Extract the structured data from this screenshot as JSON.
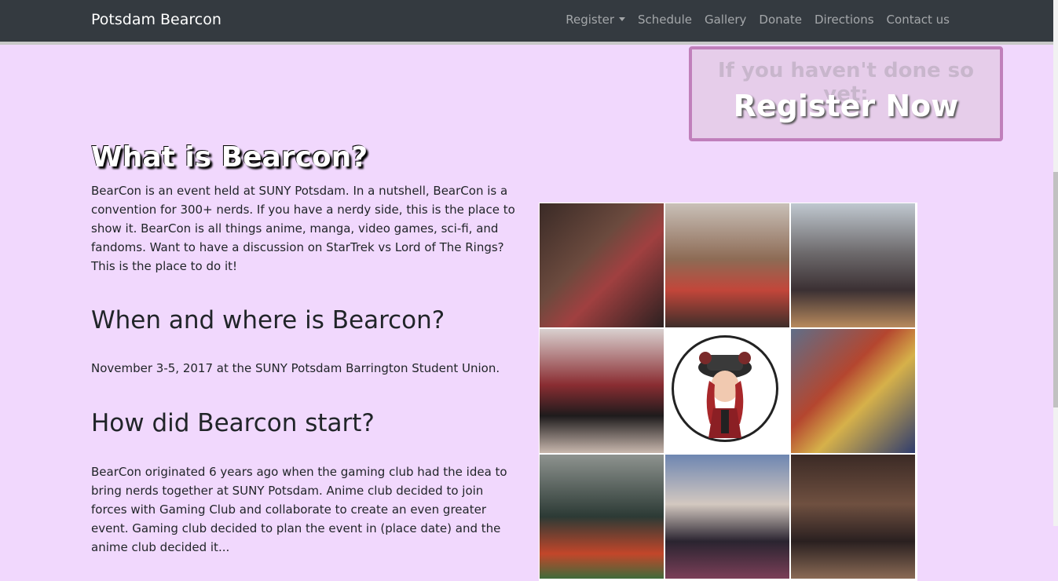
{
  "navbar": {
    "brand": "Potsdam Bearcon",
    "items": [
      {
        "label": "Register",
        "dropdown": true
      },
      {
        "label": "Schedule"
      },
      {
        "label": "Gallery"
      },
      {
        "label": "Donate"
      },
      {
        "label": "Directions"
      },
      {
        "label": "Contact us"
      }
    ]
  },
  "register_box": {
    "subtitle": "If you haven't done so yet:",
    "cta": "Register Now"
  },
  "sections": {
    "what": {
      "title": "What is Bearcon?",
      "body": "BearCon is an event held at SUNY Potsdam. In a nutshell, BearCon is a convention for 300+ nerds. If you have a nerdy side, this is the place to show it. BearCon is all things anime, manga, video games, sci-fi, and fandoms. Want to have a discussion on StarTrek vs Lord of The Rings? This is the place to do it!"
    },
    "when": {
      "title": "When and where is Bearcon?",
      "body": "November 3-5, 2017 at the SUNY Potsdam Barrington Student Union."
    },
    "how": {
      "title": "How did Bearcon start?",
      "body": "BearCon originated 6 years ago when the gaming club had the idea to bring nerds together at SUNY Potsdam. Anime club decided to join forces with Gaming Club and collaborate to create an even greater event. Gaming club decided to plan the event in (place date) and the anime club decided it..."
    }
  },
  "colors": {
    "page_bg": "#f1d8fd",
    "navbar_bg": "#343a40",
    "register_border": "#c07fbb"
  }
}
